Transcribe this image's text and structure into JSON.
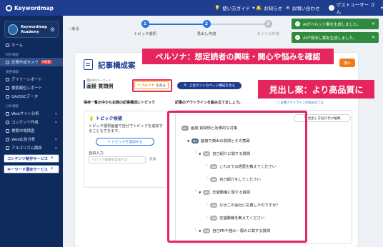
{
  "app": {
    "name": "Keywordmap"
  },
  "topbar": {
    "guide": "使い方ガイド",
    "notice": "お知らせ",
    "contact": "お問い合わせ",
    "user": "ゲストユーザー さん"
  },
  "sidebar": {
    "brand": {
      "line1": "Keywordmap",
      "line2": "Academy"
    },
    "home": "ホーム",
    "sections": {
      "production": "制作機能",
      "operation": "運用機能",
      "analysis": "分析機能"
    },
    "items": [
      {
        "label": "記事作成タスク",
        "badge": "AI搭載"
      },
      {
        "label": "デイリーレポート"
      },
      {
        "label": "検索順位レポート"
      },
      {
        "label": "GA/GSCデータ"
      },
      {
        "label": "Webサイト分析"
      },
      {
        "label": "コンテンツ作成"
      },
      {
        "label": "検索市場調査"
      },
      {
        "label": "Web広告分析"
      },
      {
        "label": "アルゴリズム解析"
      }
    ],
    "buttons": [
      "コンテンツ制作サービス",
      "キーワード選定サービス"
    ]
  },
  "main": {
    "back": "戻る",
    "steps": [
      {
        "num": "1",
        "label": "トピック選択"
      },
      {
        "num": "2",
        "label": "見出し作成"
      },
      {
        "num": "3",
        "label": "タイトル作成"
      }
    ],
    "title": "記事構成案",
    "orange_button": "次へ",
    "keyword_label": "選択中のキーワード",
    "keyword": "画接 質問例",
    "persona_prefix": "ペルソナ",
    "persona_button": "を見る",
    "top_sites_button": "上位サイトのページ構成を見る",
    "save_hint": "保存一覧の中から右側の記事構成にトピック",
    "outline_hint": "記事のアウトラインを組み立てましょう。",
    "outline_link": "記事アウトラインの組み立て方"
  },
  "topic_panel": {
    "title": "トピック候補",
    "desc": "トピック選択画面で自分でトピックを追加することもできます。",
    "add_button": "+ トピックを追加する",
    "free_label": "自由入力",
    "placeholder": "トピック候補を自由入力",
    "add_small": "追加"
  },
  "outline": {
    "paste_button": "見出しを貼り付け編集",
    "rows": [
      {
        "tag": "H1",
        "text": "画接 質問例と効果的な対策"
      },
      {
        "tag": "H2",
        "text": "面接で頻出の質問とその意図"
      },
      {
        "tag": "H3",
        "text": "自己紹介に関する質問"
      },
      {
        "tag": "H4",
        "text": "これまでの経歴を教えてください"
      },
      {
        "tag": "H4",
        "text": "自己紹介をしてください"
      },
      {
        "tag": "H3",
        "text": "志望動機に関する質問"
      },
      {
        "tag": "H4",
        "text": "なぜこの会社に応募したのですか？"
      },
      {
        "tag": "H4",
        "text": "志望動機を教えてください"
      },
      {
        "tag": "H3",
        "text": "自己PRや強み・弱みに関する質問"
      }
    ]
  },
  "banners": {
    "persona": "ペルソナ：想定読者の興味・関心や悩みを確認",
    "headings": "見出し案：より高品質に"
  },
  "toasts": [
    "AIがペルソナ案を生成しました。",
    "AIが見出し案を生成しました。"
  ],
  "colors": {
    "navy": "#1f3d8f",
    "sidebar": "#0f2a5c",
    "accent_pink": "#e6245d",
    "toast_green": "#2f8a3e",
    "orange": "#f07a1a"
  }
}
